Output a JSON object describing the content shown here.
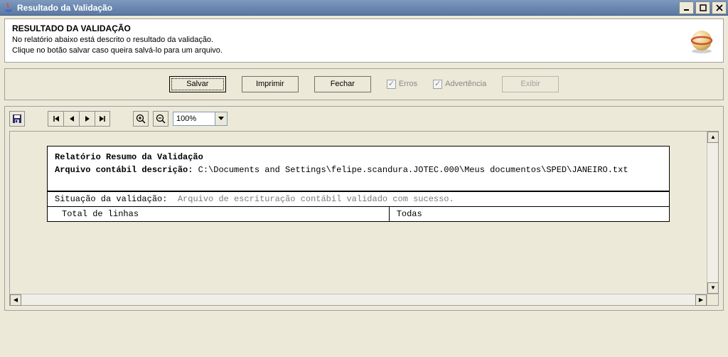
{
  "window": {
    "title": "Resultado da Validação"
  },
  "header": {
    "title": "RESULTADO DA VALIDAÇÃO",
    "line1": "No relatório abaixo está descrito o resultado da validação.",
    "line2": "Clique no botão salvar caso queira salvá-lo para um arquivo."
  },
  "buttons": {
    "save": "Salvar",
    "print": "Imprimir",
    "close": "Fechar",
    "errors": "Erros",
    "warning": "Advertência",
    "show": "Exibir"
  },
  "viewer": {
    "zoom": "100%"
  },
  "report": {
    "title": "Relatório Resumo da Validação",
    "file_label": "Arquivo contábil descrição:",
    "file_value": "C:\\Documents and Settings\\felipe.scandura.JOTEC.000\\Meus documentos\\SPED\\JANEIRO.txt",
    "status_label": "Situação da validação:",
    "status_value": "Arquivo de escrituração contábil validado com sucesso.",
    "total_label": "Total de linhas",
    "total_value": "Todas"
  }
}
